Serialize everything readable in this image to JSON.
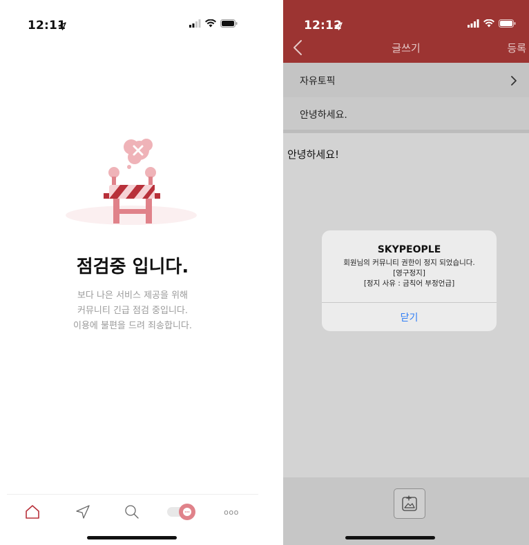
{
  "left_screen": {
    "status_time": "12:11",
    "title": "점검중 입니다.",
    "description": [
      "보다 나은 서비스 제공을 위해",
      "커뮤니티 긴급 점검 중입니다.",
      "이용에 불편을 드려 죄송합니다."
    ],
    "tabs": [
      "home-icon",
      "send-icon",
      "search-icon",
      "chat-toggle-icon",
      "more-icon"
    ],
    "more_label": "ooo"
  },
  "right_screen": {
    "status_time": "12:12",
    "nav": {
      "title": "글쓰기",
      "submit": "등록"
    },
    "topic": "자유토픽",
    "subject": "안녕하세요.",
    "body": "안녕하세요!",
    "dialog": {
      "title": "SKYPEOPLE",
      "lines": [
        "회원님의 커뮤니티 권한이 정지 되었습니다.",
        "[영구정지]",
        "[정지 사유 : 금칙어 부정언급]"
      ],
      "button": "닫기"
    }
  },
  "colors": {
    "brand_red": "#9c3432",
    "accent_pink": "#e0828a",
    "link_blue": "#2f7ef6"
  }
}
